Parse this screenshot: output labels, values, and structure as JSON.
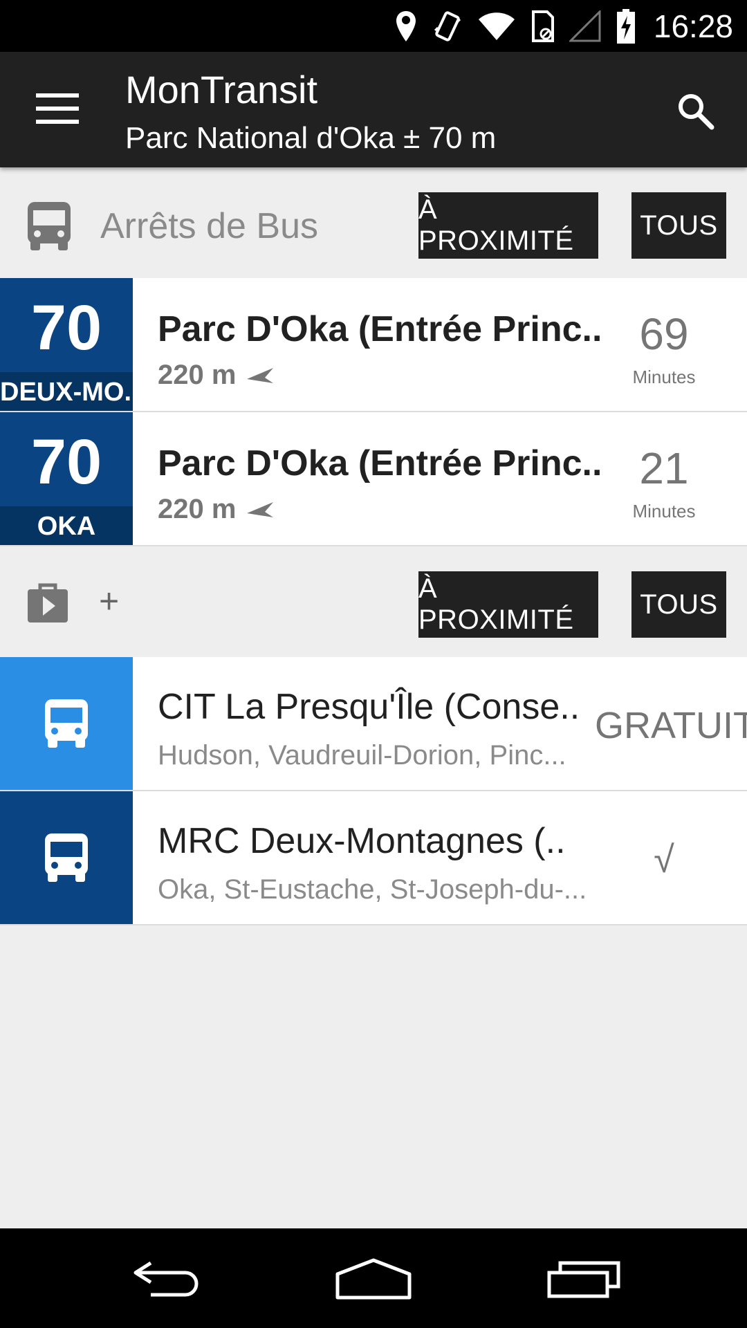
{
  "status_bar": {
    "time": "16:28",
    "icons": [
      "location-icon",
      "vibrate-icon",
      "wifi-icon",
      "sim-icon",
      "signal-icon",
      "battery-charging-icon"
    ]
  },
  "app_bar": {
    "title": "MonTransit",
    "subtitle": "Parc National d'Oka ± 70 m",
    "menu_icon": "menu-icon",
    "search_icon": "search-icon"
  },
  "bus_section": {
    "title": "Arrêts de Bus",
    "icon": "bus-icon",
    "nearby_label": "À PROXIMITÉ",
    "all_label": "TOUS",
    "stops": [
      {
        "route": "70",
        "direction": "DEUX-MO..",
        "name": "Parc D'Oka (Entrée Princ..",
        "distance": "220 m",
        "eta": "69",
        "eta_unit": "Minutes",
        "badge_color": "#0a4482"
      },
      {
        "route": "70",
        "direction": "OKA",
        "name": "Parc D'Oka (Entrée Princ..",
        "distance": "220 m",
        "eta": "21",
        "eta_unit": "Minutes",
        "badge_color": "#0a4482"
      }
    ]
  },
  "store_section": {
    "icon": "play-store-icon",
    "plus": "+",
    "nearby_label": "À PROXIMITÉ",
    "all_label": "TOUS",
    "agencies": [
      {
        "name": "CIT La Presqu'Île (Conse..",
        "cities": "Hudson, Vaudreuil-Dorion, Pinc...",
        "status": "GRATUIT",
        "color": "#2a8fe4"
      },
      {
        "name": "MRC Deux-Montagnes (..",
        "cities": "Oka, St-Eustache, St-Joseph-du-...",
        "status": "√",
        "color": "#0a4482"
      }
    ]
  },
  "nav_bar": {
    "icons": [
      "back-icon",
      "home-icon",
      "recents-icon"
    ]
  }
}
